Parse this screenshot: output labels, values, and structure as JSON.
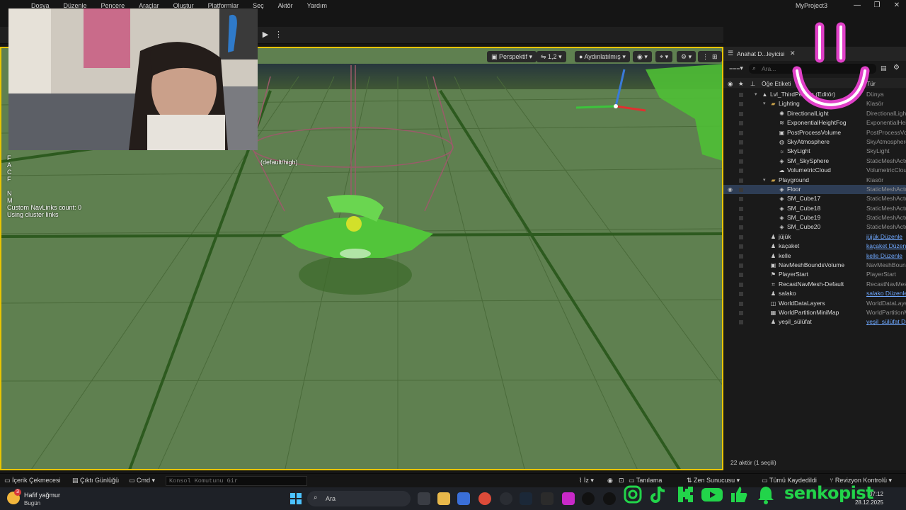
{
  "menubar": {
    "items": [
      "Dosya",
      "Düzenle",
      "Pencere",
      "Araçlar",
      "Oluştur",
      "Platformlar",
      "Seç",
      "Aktör",
      "Yardım"
    ],
    "project_title": "MyProject3"
  },
  "window_controls": {
    "minimize": "—",
    "restore": "❐",
    "close": "✕"
  },
  "viewport": {
    "perspective_label": "Perspektif",
    "camera_speed_label": "1,2",
    "lit_label": "Aydınlatılmış",
    "stats_lines": [
      "F",
      "A",
      "C",
      "F",
      "",
      "N",
      "M",
      "Custom NavLinks count: 0",
      "Using cluster links"
    ],
    "stat_suffix": "(default/high)"
  },
  "outliner": {
    "tab_label": "Anahat D...leyicisi",
    "search_placeholder": "Ara...",
    "header": {
      "label_col": "Öğe Etiketi",
      "type_col": "Tür"
    },
    "footer": "22 aktör (1 seçili)",
    "rows": [
      {
        "label": "Lvl_ThirdPerson (Editör)",
        "type": "Dünya",
        "indent": 0,
        "icon": "world-icon",
        "arrow": "▾",
        "link": false,
        "selected": false,
        "vis": false
      },
      {
        "label": "Lighting",
        "type": "Klasör",
        "indent": 1,
        "icon": "folder-icon",
        "arrow": "▾",
        "link": false,
        "selected": false,
        "vis": false
      },
      {
        "label": "DirectionalLight",
        "type": "DirectionalLight",
        "indent": 2,
        "icon": "light-icon",
        "arrow": "",
        "link": false,
        "selected": false,
        "vis": false
      },
      {
        "label": "ExponentialHeightFog",
        "type": "ExponentialHeightFog",
        "indent": 2,
        "icon": "fog-icon",
        "arrow": "",
        "link": false,
        "selected": false,
        "vis": false
      },
      {
        "label": "PostProcessVolume",
        "type": "PostProcessVolume",
        "indent": 2,
        "icon": "volume-icon",
        "arrow": "",
        "link": false,
        "selected": false,
        "vis": false
      },
      {
        "label": "SkyAtmosphere",
        "type": "SkyAtmosphere",
        "indent": 2,
        "icon": "atmosphere-icon",
        "arrow": "",
        "link": false,
        "selected": false,
        "vis": false
      },
      {
        "label": "SkyLight",
        "type": "SkyLight",
        "indent": 2,
        "icon": "skylight-icon",
        "arrow": "",
        "link": false,
        "selected": false,
        "vis": false
      },
      {
        "label": "SM_SkySphere",
        "type": "StaticMeshActor",
        "indent": 2,
        "icon": "mesh-icon",
        "arrow": "",
        "link": false,
        "selected": false,
        "vis": false
      },
      {
        "label": "VolumetricCloud",
        "type": "VolumetricCloud",
        "indent": 2,
        "icon": "cloud-icon",
        "arrow": "",
        "link": false,
        "selected": false,
        "vis": false
      },
      {
        "label": "Playground",
        "type": "Klasör",
        "indent": 1,
        "icon": "folder-icon",
        "arrow": "▾",
        "link": false,
        "selected": false,
        "vis": false
      },
      {
        "label": "Floor",
        "type": "StaticMeshActor",
        "indent": 2,
        "icon": "mesh-icon",
        "arrow": "",
        "link": false,
        "selected": true,
        "vis": true
      },
      {
        "label": "SM_Cube17",
        "type": "StaticMeshActor",
        "indent": 2,
        "icon": "mesh-icon",
        "arrow": "",
        "link": false,
        "selected": false,
        "vis": false
      },
      {
        "label": "SM_Cube18",
        "type": "StaticMeshActor",
        "indent": 2,
        "icon": "mesh-icon",
        "arrow": "",
        "link": false,
        "selected": false,
        "vis": false
      },
      {
        "label": "SM_Cube19",
        "type": "StaticMeshActor",
        "indent": 2,
        "icon": "mesh-icon",
        "arrow": "",
        "link": false,
        "selected": false,
        "vis": false
      },
      {
        "label": "SM_Cube20",
        "type": "StaticMeshActor",
        "indent": 2,
        "icon": "mesh-icon",
        "arrow": "",
        "link": false,
        "selected": false,
        "vis": false
      },
      {
        "label": "jüjük",
        "type": "jüjük Düzenle",
        "indent": 1,
        "icon": "pawn-icon",
        "arrow": "",
        "link": true,
        "selected": false,
        "vis": false
      },
      {
        "label": "kaçaket",
        "type": "kaçaket Düzenle",
        "indent": 1,
        "icon": "pawn-icon",
        "arrow": "",
        "link": true,
        "selected": false,
        "vis": false
      },
      {
        "label": "kelle",
        "type": "kelle Düzenle",
        "indent": 1,
        "icon": "pawn-icon",
        "arrow": "",
        "link": true,
        "selected": false,
        "vis": false
      },
      {
        "label": "NavMeshBoundsVolume",
        "type": "NavMeshBoundsVolume",
        "indent": 1,
        "icon": "volume-icon",
        "arrow": "",
        "link": false,
        "selected": false,
        "vis": false
      },
      {
        "label": "PlayerStart",
        "type": "PlayerStart",
        "indent": 1,
        "icon": "player-start-icon",
        "arrow": "",
        "link": false,
        "selected": false,
        "vis": false
      },
      {
        "label": "RecastNavMesh-Default",
        "type": "RecastNavMesh",
        "indent": 1,
        "icon": "navmesh-icon",
        "arrow": "",
        "link": false,
        "selected": false,
        "vis": false
      },
      {
        "label": "salako",
        "type": "salako Düzenle",
        "indent": 1,
        "icon": "pawn-icon",
        "arrow": "",
        "link": true,
        "selected": false,
        "vis": false
      },
      {
        "label": "WorldDataLayers",
        "type": "WorldDataLayers",
        "indent": 1,
        "icon": "layers-icon",
        "arrow": "",
        "link": false,
        "selected": false,
        "vis": false
      },
      {
        "label": "WorldPartitionMiniMap",
        "type": "WorldPartitionMiniMap",
        "indent": 1,
        "icon": "map-icon",
        "arrow": "",
        "link": false,
        "selected": false,
        "vis": false
      },
      {
        "label": "yeşil_sülüfat",
        "type": "yeşil_sülüfat Düzenle",
        "indent": 1,
        "icon": "pawn-icon",
        "arrow": "",
        "link": true,
        "selected": false,
        "vis": false
      }
    ]
  },
  "bottombar": {
    "content_drawer": "İçerik Çekmecesi",
    "output_log": "Çıktı Günlüğü",
    "cmd": "Cmd",
    "console_placeholder": "Konsol Komutunu Gir",
    "trace": "İz",
    "diagnostics": "Tanılama",
    "zen_server": "Zen Sunucusu",
    "save_all": "Tümü Kaydedildi",
    "revision_control": "Revizyon Kontrolü"
  },
  "taskbar": {
    "weather_title": "Hafif yağmur",
    "weather_sub": "Bugün",
    "weather_badge": "3",
    "search_placeholder": "Ara",
    "time": "07:12",
    "date": "28.12.2025"
  },
  "overlay": {
    "social_name": "senkopist",
    "accent_green": "#22d44a",
    "smiley_color": "#e040c8"
  },
  "colors": {
    "floor_green": "#5d7e4e",
    "selection_outline": "#e9c500",
    "link_blue": "#6fa8ff"
  }
}
